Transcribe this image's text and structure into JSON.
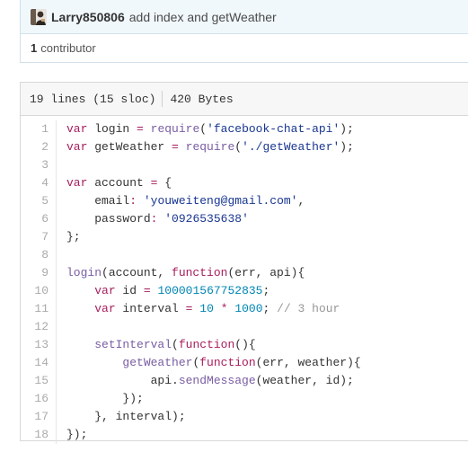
{
  "commit": {
    "author": "Larry850806",
    "message": "add index and getWeather",
    "contributor_count": "1",
    "contributor_label": "contributor"
  },
  "file": {
    "lines_info": "19 lines (15 sloc)",
    "size": "420 Bytes"
  },
  "code": {
    "line_numbers": [
      "1",
      "2",
      "3",
      "4",
      "5",
      "6",
      "7",
      "8",
      "9",
      "10",
      "11",
      "12",
      "13",
      "14",
      "15",
      "16",
      "17",
      "18"
    ],
    "lines": [
      [
        [
          "kw",
          "var"
        ],
        [
          "t",
          " login "
        ],
        [
          "op",
          "="
        ],
        [
          "t",
          " "
        ],
        [
          "fn",
          "require"
        ],
        [
          "t",
          "("
        ],
        [
          "str",
          "'facebook-chat-api'"
        ],
        [
          "t",
          ");"
        ]
      ],
      [
        [
          "kw",
          "var"
        ],
        [
          "t",
          " getWeather "
        ],
        [
          "op",
          "="
        ],
        [
          "t",
          " "
        ],
        [
          "fn",
          "require"
        ],
        [
          "t",
          "("
        ],
        [
          "str",
          "'./getWeather'"
        ],
        [
          "t",
          ");"
        ]
      ],
      [],
      [
        [
          "kw",
          "var"
        ],
        [
          "t",
          " account "
        ],
        [
          "op",
          "="
        ],
        [
          "t",
          " {"
        ]
      ],
      [
        [
          "t",
          "    email"
        ],
        [
          "op",
          ":"
        ],
        [
          "t",
          " "
        ],
        [
          "str",
          "'youweiteng@gmail.com'"
        ],
        [
          "t",
          ","
        ]
      ],
      [
        [
          "t",
          "    password"
        ],
        [
          "op",
          ":"
        ],
        [
          "t",
          " "
        ],
        [
          "str",
          "'0926535638'"
        ]
      ],
      [
        [
          "t",
          "};"
        ]
      ],
      [],
      [
        [
          "fn",
          "login"
        ],
        [
          "t",
          "(account, "
        ],
        [
          "kw",
          "function"
        ],
        [
          "t",
          "(err, api){"
        ]
      ],
      [
        [
          "t",
          "    "
        ],
        [
          "kw",
          "var"
        ],
        [
          "t",
          " id "
        ],
        [
          "op",
          "="
        ],
        [
          "t",
          " "
        ],
        [
          "num",
          "100001567752835"
        ],
        [
          "t",
          ";"
        ]
      ],
      [
        [
          "t",
          "    "
        ],
        [
          "kw",
          "var"
        ],
        [
          "t",
          " interval "
        ],
        [
          "op",
          "="
        ],
        [
          "t",
          " "
        ],
        [
          "num",
          "10"
        ],
        [
          "t",
          " "
        ],
        [
          "op",
          "*"
        ],
        [
          "t",
          " "
        ],
        [
          "num",
          "1000"
        ],
        [
          "t",
          "; "
        ],
        [
          "cm",
          "// 3 hour"
        ]
      ],
      [],
      [
        [
          "t",
          "    "
        ],
        [
          "fn",
          "setInterval"
        ],
        [
          "t",
          "("
        ],
        [
          "kw",
          "function"
        ],
        [
          "t",
          "(){"
        ]
      ],
      [
        [
          "t",
          "        "
        ],
        [
          "fn",
          "getWeather"
        ],
        [
          "t",
          "("
        ],
        [
          "kw",
          "function"
        ],
        [
          "t",
          "(err, weather){"
        ]
      ],
      [
        [
          "t",
          "            api."
        ],
        [
          "fn",
          "sendMessage"
        ],
        [
          "t",
          "(weather, id);"
        ]
      ],
      [
        [
          "t",
          "        });"
        ]
      ],
      [
        [
          "t",
          "    }, interval);"
        ]
      ],
      [
        [
          "t",
          "});"
        ]
      ]
    ]
  },
  "colors": {
    "keyword": "#a71d5d",
    "string": "#183691",
    "function": "#795da3",
    "number": "#0086b3",
    "comment": "#969896",
    "header_bg": "#f1f8fc"
  },
  "icons": {
    "avatar": "user-avatar-image"
  }
}
